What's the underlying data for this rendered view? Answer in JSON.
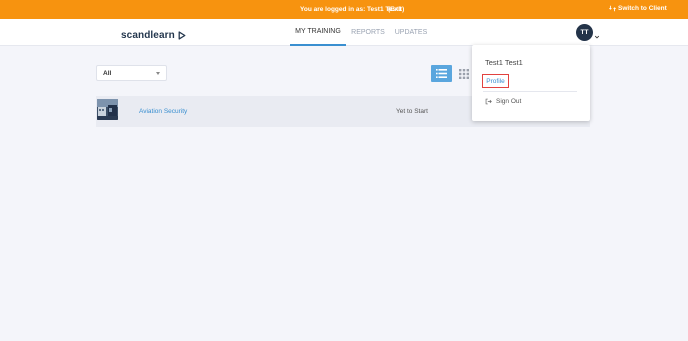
{
  "banner": {
    "message": "You are logged in as: Test1 Test1",
    "exit_label": "(Exit)",
    "switch_label": "Switch to Client",
    "switch_icon": "switch-arrows-icon",
    "color": "#f7930f"
  },
  "header": {
    "logo_text": "scandlearn",
    "logo_icon": "play-triangle-icon",
    "nav": [
      {
        "label": "MY TRAINING",
        "active": true
      },
      {
        "label": "REPORTS",
        "active": false
      },
      {
        "label": "UPDATES",
        "active": false
      }
    ],
    "avatar_initials": "TT",
    "avatar_color": "#233349",
    "accent": "#3a8fd0"
  },
  "filter": {
    "value": "All"
  },
  "view_toggle": {
    "list_icon": "list-view-icon",
    "grid_icon": "grid-view-icon",
    "selected": "list"
  },
  "courses": [
    {
      "name": "Aviation Security",
      "status": "Yet to Start",
      "thumbnail": "aviation-thumbnail"
    }
  ],
  "user_menu": {
    "name": "Test1 Test1",
    "items": [
      {
        "label": "Profile",
        "highlighted": true
      },
      {
        "label": "Sign Out",
        "icon": "sign-out-icon"
      }
    ]
  }
}
